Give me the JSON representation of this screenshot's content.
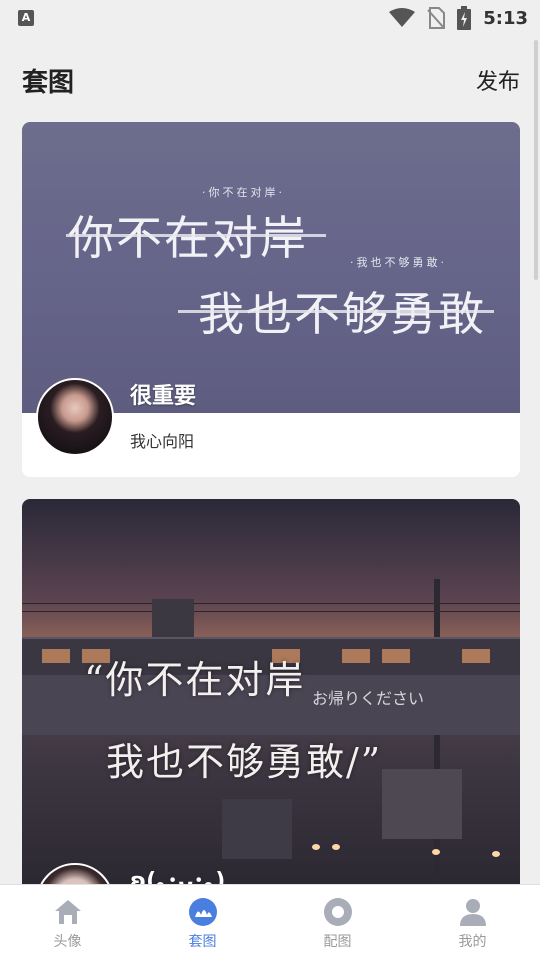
{
  "status_bar": {
    "left_icon": "A",
    "time": "5:13",
    "icons": [
      "wifi-icon",
      "no-sim-icon",
      "battery-charging-icon"
    ]
  },
  "header": {
    "title": "套图",
    "publish_label": "发布"
  },
  "cards": [
    {
      "title": "很重要",
      "subtitle": "我心向阳",
      "image_texts": {
        "small_top": "·你不在对岸·",
        "line1": "你不在对岸",
        "small_right": "·我也不够勇敢·",
        "line2": "我也不够勇敢"
      }
    },
    {
      "title": "ʚ(｡･ᴗ･｡)",
      "subtitle": "",
      "image_texts": {
        "line1": "“你不在对岸",
        "line2": "我也不够勇敢/”",
        "sign": "お帰りください"
      }
    }
  ],
  "bottom_nav": {
    "items": [
      {
        "label": "头像",
        "icon": "house-icon",
        "active": false
      },
      {
        "label": "套图",
        "icon": "album-icon",
        "active": true
      },
      {
        "label": "配图",
        "icon": "ring-icon",
        "active": false
      },
      {
        "label": "我的",
        "icon": "person-icon",
        "active": false
      }
    ]
  },
  "colors": {
    "accent": "#4a7fe0",
    "inactive": "#9a9a9a",
    "background": "#efefef"
  }
}
